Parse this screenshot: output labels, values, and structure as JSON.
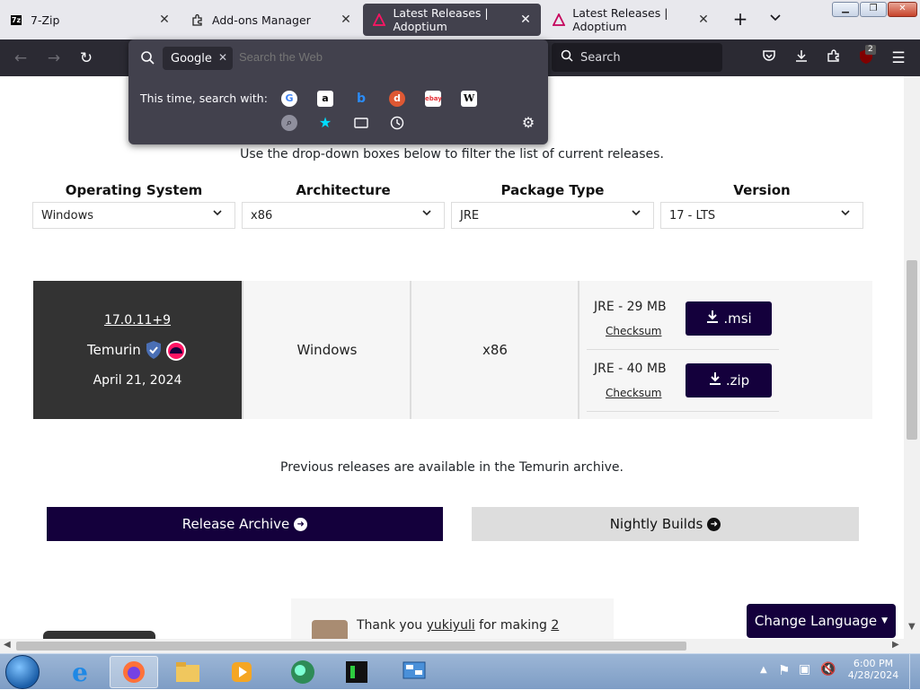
{
  "tabs": [
    {
      "title": "7-Zip",
      "icon": "7zip-icon"
    },
    {
      "title": "Add-ons Manager",
      "icon": "puzzle-icon"
    },
    {
      "title": "Latest Releases | Adoptium",
      "icon": "adoptium-icon",
      "active": true
    },
    {
      "title": "Latest Releases | Adoptium",
      "icon": "adoptium-icon"
    }
  ],
  "tab_close_glyph": "✕",
  "urlbar": {
    "engine": "Google",
    "placeholder": "Search the Web",
    "search_with_label": "This time, search with:"
  },
  "toolbar": {
    "search_placeholder": "Search",
    "extension_badge": "2"
  },
  "page": {
    "filter_intro": "Use the drop-down boxes below to filter the list of current releases.",
    "filters": [
      {
        "label": "Operating System",
        "value": "Windows"
      },
      {
        "label": "Architecture",
        "value": "x86"
      },
      {
        "label": "Package Type",
        "value": "JRE"
      },
      {
        "label": "Version",
        "value": "17 - LTS"
      }
    ],
    "release": {
      "version": "17.0.11+9",
      "vendor": "Temurin",
      "date": "April 21, 2024",
      "os": "Windows",
      "arch": "x86",
      "packages": [
        {
          "label": "JRE - 29 MB",
          "checksum": "Checksum",
          "button": ".msi"
        },
        {
          "label": "JRE - 40 MB",
          "checksum": "Checksum",
          "button": ".zip"
        }
      ]
    },
    "archive_note": "Previous releases are available in the Temurin archive.",
    "release_archive_button": "Release Archive",
    "nightly_builds_button": "Nightly Builds",
    "thanks": {
      "prefix": "Thank you",
      "user": "yukiyuli",
      "middle": "for making",
      "count": "2"
    },
    "change_language": "Change Language"
  },
  "taskbar": {
    "time": "6:00 PM",
    "date": "4/28/2024"
  },
  "colors": {
    "accent": "#14003c",
    "dark_card": "#333333",
    "toolbar": "#2b2a33",
    "popup": "#42414d"
  }
}
